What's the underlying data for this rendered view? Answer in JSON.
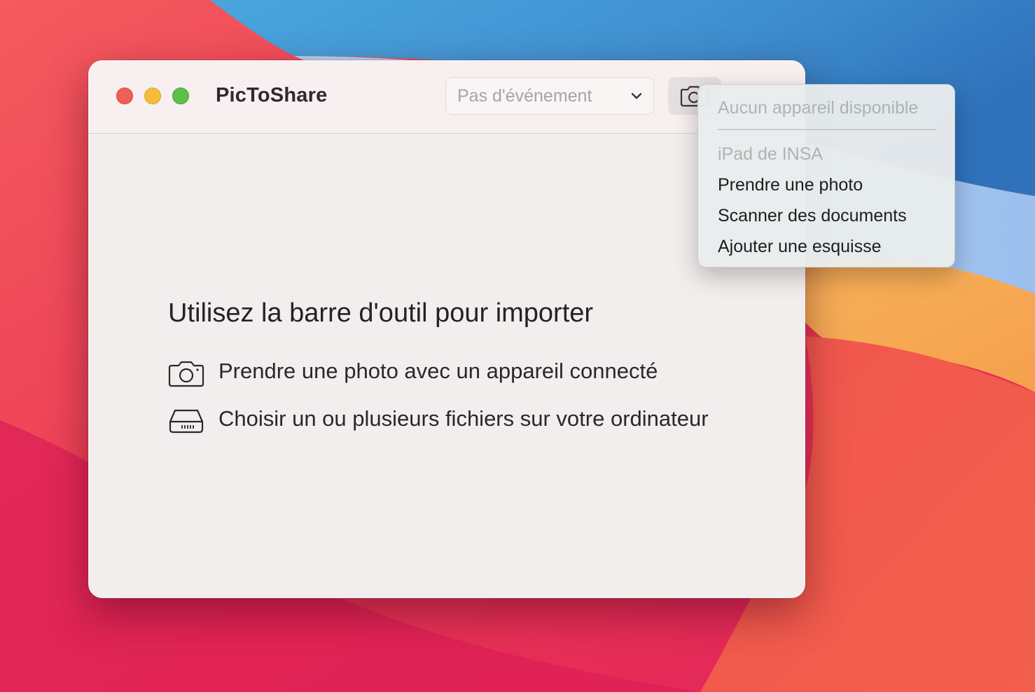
{
  "window": {
    "title": "PicToShare",
    "controls": [
      "close",
      "minimize",
      "zoom"
    ]
  },
  "toolbar": {
    "event_select": {
      "value": "Pas d'événement",
      "icon": "chevron-down-icon"
    },
    "camera_button": {
      "icon": "camera-icon"
    }
  },
  "content": {
    "heading": "Utilisez la barre d'outil pour importer",
    "actions": [
      {
        "icon": "camera-icon",
        "label": "Prendre une photo avec un appareil connecté"
      },
      {
        "icon": "hard-drive-icon",
        "label": "Choisir un ou plusieurs fichiers sur votre ordinateur"
      }
    ]
  },
  "menu": {
    "header": "Aucun appareil disponible",
    "device": "iPad de INSA",
    "items": [
      "Prendre une photo",
      "Scanner des documents",
      "Ajouter une esquisse"
    ]
  },
  "colors": {
    "traffic_close": "#ee5f5a",
    "traffic_minimize": "#f6bd3b",
    "traffic_zoom": "#5ac147",
    "window_bg": "#f3eeee"
  }
}
